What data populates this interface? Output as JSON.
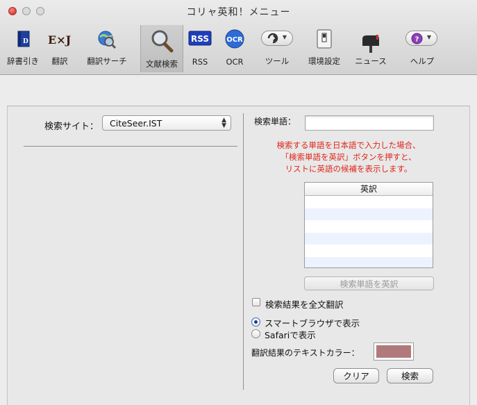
{
  "window": {
    "title": "コリャ英和！メニュー"
  },
  "toolbar": {
    "items": [
      {
        "label": "辞書引き",
        "icon": "dictionary-icon"
      },
      {
        "label": "翻訳",
        "icon": "ej-translate-icon"
      },
      {
        "label": "翻訳サーチ",
        "icon": "globe-search-icon"
      },
      {
        "label": "文献検索",
        "icon": "magnifier-icon"
      },
      {
        "label": "RSS",
        "icon": "rss-icon"
      },
      {
        "label": "OCR",
        "icon": "ocr-icon"
      },
      {
        "label": "ツール",
        "icon": "tools-icon"
      },
      {
        "label": "環境設定",
        "icon": "settings-switch-icon"
      },
      {
        "label": "ニュース",
        "icon": "mailbox-icon"
      },
      {
        "label": "ヘルプ",
        "icon": "help-icon"
      }
    ],
    "rss_badge": "RSS",
    "ocr_badge": "OCR",
    "ej_badge": "E×J",
    "help_glyph": "?"
  },
  "search": {
    "site_label": "検索サイト：",
    "site_value": "CiteSeer.IST",
    "term_label": "検索単語：",
    "term_value": "",
    "hint_lines": [
      "検索する単語を日本語で入力した場合、",
      "「検索単語を英訳」ボタンを押すと、",
      "リストに英語の候補を表示します。"
    ],
    "table_header": "英訳",
    "translate_button": "検索単語を英訳",
    "fulltext_checkbox": "検索結果を全文翻訳",
    "fulltext_checked": false,
    "radio_smart": "スマートブラウザで表示",
    "radio_safari": "Safariで表示",
    "color_label": "翻訳結果のテキストカラー：",
    "text_color": "#b07a7c",
    "clear_button": "クリア",
    "search_button": "検索"
  },
  "colors": {
    "hint": "#e0251b",
    "accent": "#1b3b8a"
  }
}
